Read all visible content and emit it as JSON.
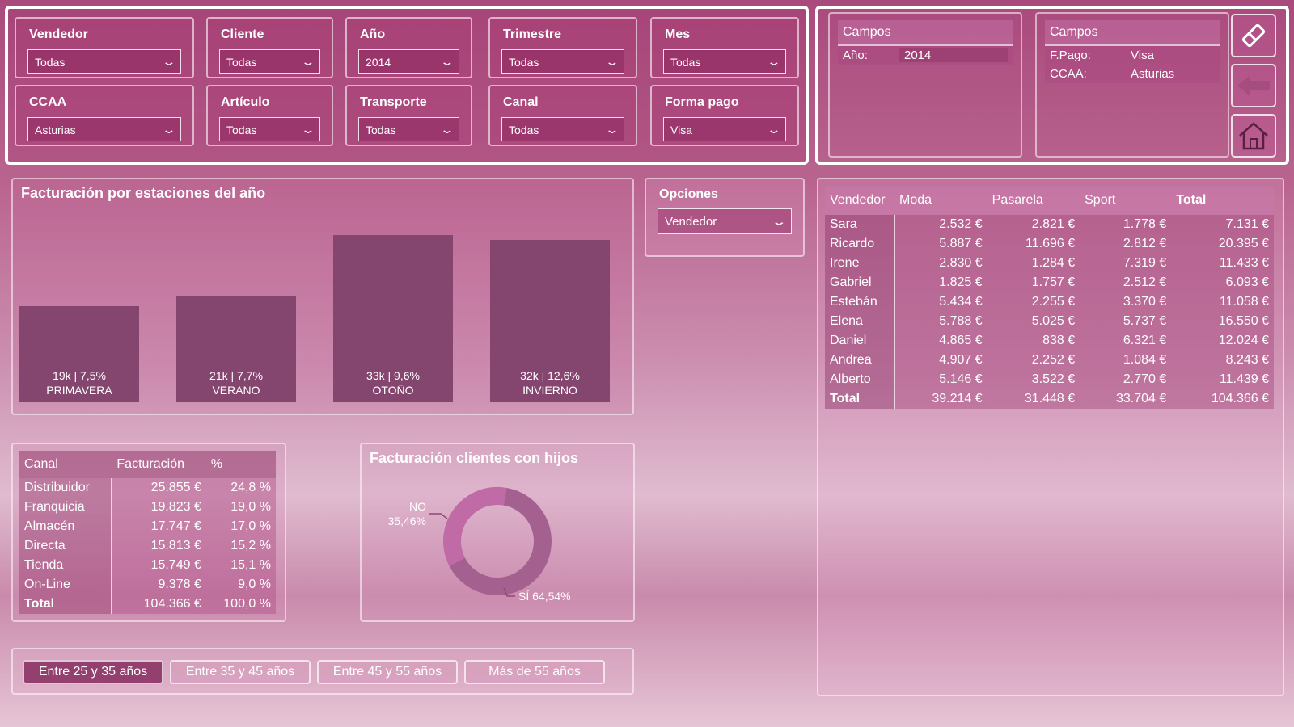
{
  "filters": {
    "slicers": [
      {
        "label": "Vendedor",
        "value": "Todas"
      },
      {
        "label": "Cliente",
        "value": "Todas"
      },
      {
        "label": "Año",
        "value": "2014"
      },
      {
        "label": "Trimestre",
        "value": "Todas"
      },
      {
        "label": "Mes",
        "value": "Todas"
      },
      {
        "label": "CCAA",
        "value": "Asturias"
      },
      {
        "label": "Artículo",
        "value": "Todas"
      },
      {
        "label": "Transporte",
        "value": "Todas"
      },
      {
        "label": "Canal",
        "value": "Todas"
      },
      {
        "label": "Forma pago",
        "value": "Visa"
      }
    ]
  },
  "campos": [
    {
      "title": "Campos",
      "rows": [
        {
          "k": "Año:",
          "v": "2014"
        }
      ]
    },
    {
      "title": "Campos",
      "rows": [
        {
          "k": "F.Pago:",
          "v": "Visa"
        },
        {
          "k": "CCAA:",
          "v": "Asturias"
        }
      ]
    }
  ],
  "icons": {
    "eraser": "eraser-icon",
    "back": "back-arrow-icon",
    "home": "home-icon"
  },
  "season_chart": {
    "title": "Facturación por estaciones del año",
    "chart_data": {
      "type": "bar",
      "categories": [
        "PRIMAVERA",
        "VERANO",
        "OTOÑO",
        "INVIERNO"
      ],
      "values": [
        19,
        21,
        33,
        32
      ],
      "data_labels": [
        "19k | 7,5%",
        "21k | 7,7%",
        "33k | 9,6%",
        "32k | 12,6%"
      ],
      "ylim": [
        0,
        35
      ],
      "color": "#84456f"
    }
  },
  "opciones": {
    "label": "Opciones",
    "value": "Vendedor"
  },
  "vendor_table": {
    "headers": [
      "Vendedor",
      "Moda",
      "Pasarela",
      "Sport",
      "Total"
    ],
    "rows": [
      [
        "Sara",
        "2.532 €",
        "2.821 €",
        "1.778 €",
        "7.131 €"
      ],
      [
        "Ricardo",
        "5.887 €",
        "11.696 €",
        "2.812 €",
        "20.395 €"
      ],
      [
        "Irene",
        "2.830 €",
        "1.284 €",
        "7.319 €",
        "11.433 €"
      ],
      [
        "Gabriel",
        "1.825 €",
        "1.757 €",
        "2.512 €",
        "6.093 €"
      ],
      [
        "Estebán",
        "5.434 €",
        "2.255 €",
        "3.370 €",
        "11.058 €"
      ],
      [
        "Elena",
        "5.788 €",
        "5.025 €",
        "5.737 €",
        "16.550 €"
      ],
      [
        "Daniel",
        "4.865 €",
        "838 €",
        "6.321 €",
        "12.024 €"
      ],
      [
        "Andrea",
        "4.907 €",
        "2.252 €",
        "1.084 €",
        "8.243 €"
      ],
      [
        "Alberto",
        "5.146 €",
        "3.522 €",
        "2.770 €",
        "11.439 €"
      ]
    ],
    "total": [
      "Total",
      "39.214 €",
      "31.448 €",
      "33.704 €",
      "104.366 €"
    ]
  },
  "canal_table": {
    "headers": [
      "Canal",
      "Facturación",
      "%"
    ],
    "rows": [
      [
        "Distribuidor",
        "25.855 €",
        "24,8 %"
      ],
      [
        "Franquicia",
        "19.823 €",
        "19,0 %"
      ],
      [
        "Almacén",
        "17.747 €",
        "17,0 %"
      ],
      [
        "Directa",
        "15.813 €",
        "15,2 %"
      ],
      [
        "Tienda",
        "15.749 €",
        "15,1 %"
      ],
      [
        "On-Line",
        "9.378 €",
        "9,0 %"
      ]
    ],
    "total": [
      "Total",
      "104.366 €",
      "100,0 %"
    ]
  },
  "donut": {
    "title": "Facturación clientes con hijos",
    "chart_data": {
      "type": "pie",
      "categories": [
        "NO",
        "SÍ"
      ],
      "values": [
        35.46,
        64.54
      ],
      "labels": [
        "35,46%",
        "SÍ 64,54%"
      ],
      "colors": [
        "#c06aa6",
        "#a4618f"
      ]
    }
  },
  "age_buttons": [
    "Entre 25 y 35 años",
    "Entre 35 y 45 años",
    "Entre 45 y 55 años",
    "Más de 55 años"
  ]
}
